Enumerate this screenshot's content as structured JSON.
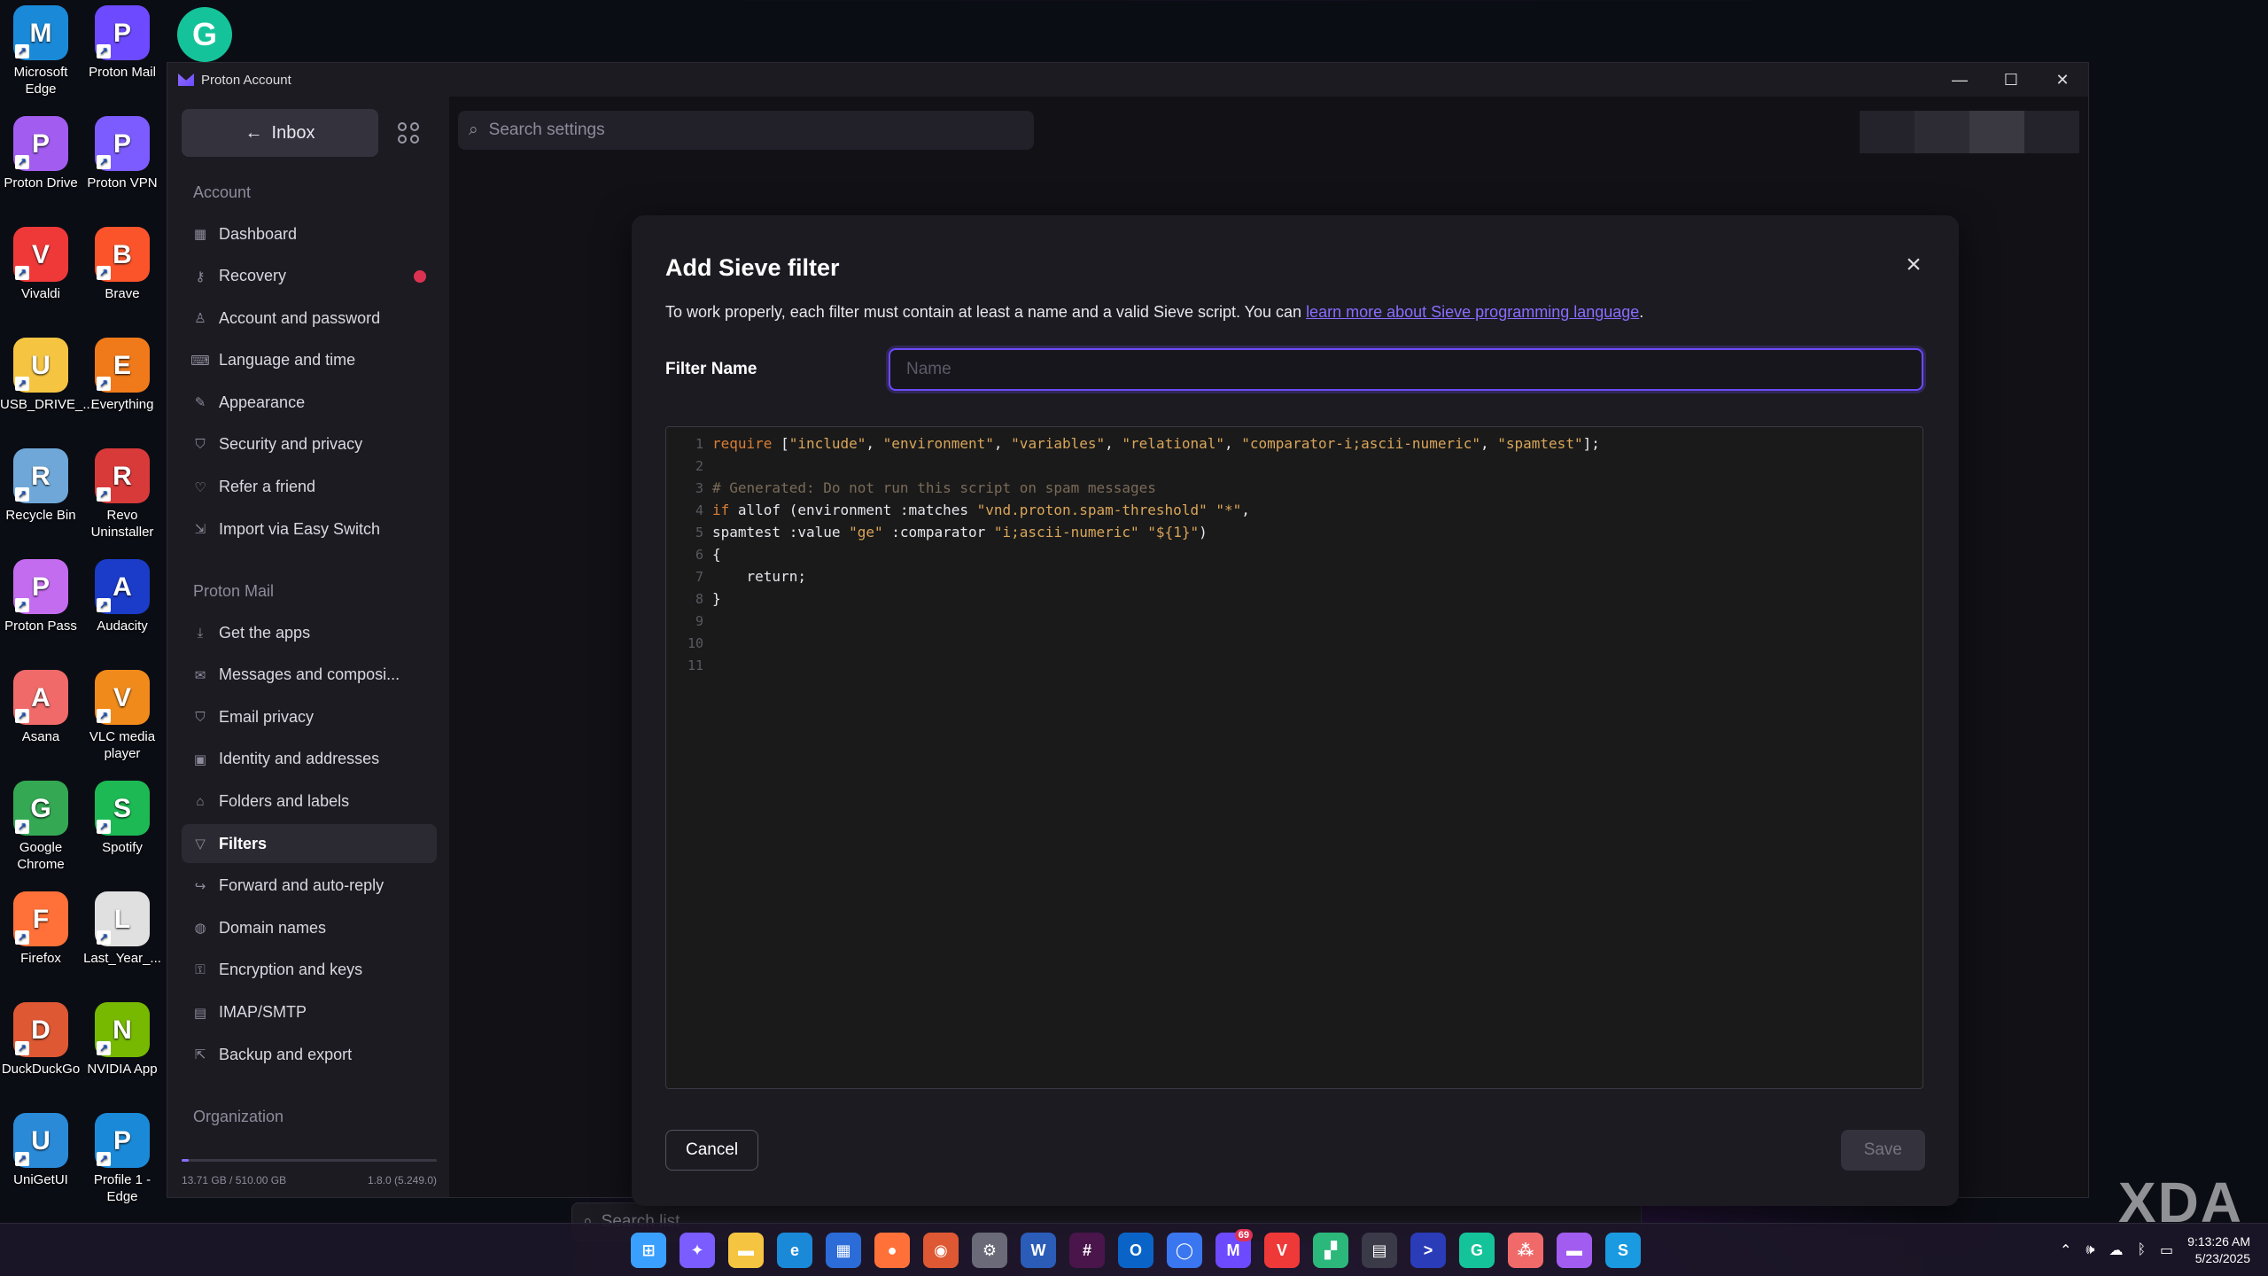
{
  "desktop": {
    "icons": [
      {
        "label": "Microsoft Edge",
        "icon": "edge-icon",
        "color": "#1a8ad8"
      },
      {
        "label": "Proton Mail",
        "icon": "proton-mail-icon",
        "color": "#6d4aff"
      },
      {
        "label": "Proton Drive",
        "icon": "proton-drive-icon",
        "color": "#a25cf0"
      },
      {
        "label": "Proton VPN",
        "icon": "proton-vpn-icon",
        "color": "#7d5cff"
      },
      {
        "label": "Vivaldi",
        "icon": "vivaldi-icon",
        "color": "#ef3939"
      },
      {
        "label": "Brave",
        "icon": "brave-icon",
        "color": "#fb542b"
      },
      {
        "label": "USB_DRIVE_...",
        "icon": "folder-icon",
        "color": "#f5c542"
      },
      {
        "label": "Everything",
        "icon": "everything-icon",
        "color": "#f07a1a"
      },
      {
        "label": "Recycle Bin",
        "icon": "recycle-bin-icon",
        "color": "#6fa8d8"
      },
      {
        "label": "Revo Uninstaller",
        "icon": "revo-uninstaller-icon",
        "color": "#d83a3a"
      },
      {
        "label": "Proton Pass",
        "icon": "proton-pass-icon",
        "color": "#c46cf0"
      },
      {
        "label": "Audacity",
        "icon": "audacity-icon",
        "color": "#1a3cc8"
      },
      {
        "label": "Asana",
        "icon": "asana-icon",
        "color": "#f06a6a"
      },
      {
        "label": "VLC media player",
        "icon": "vlc-icon",
        "color": "#f08a1a"
      },
      {
        "label": "Google Chrome",
        "icon": "chrome-icon",
        "color": "#34a853"
      },
      {
        "label": "Spotify",
        "icon": "spotify-icon",
        "color": "#1db954"
      },
      {
        "label": "Firefox",
        "icon": "firefox-icon",
        "color": "#ff7139"
      },
      {
        "label": "Last_Year_...",
        "icon": "document-icon",
        "color": "#e0e0e0"
      },
      {
        "label": "DuckDuckGo",
        "icon": "duckduckgo-icon",
        "color": "#de5833"
      },
      {
        "label": "NVIDIA App",
        "icon": "nvidia-icon",
        "color": "#76b900"
      },
      {
        "label": "UniGetUI",
        "icon": "unigetui-icon",
        "color": "#2a8ad8"
      },
      {
        "label": "Profile 1 - Edge",
        "icon": "edge-icon",
        "color": "#1a8ad8"
      }
    ],
    "top_icon": {
      "icon": "grammarly-icon",
      "color": "#15c39a"
    }
  },
  "window": {
    "title": "Proton Account",
    "controls": {
      "minimize": "—",
      "maximize": "☐",
      "close": "✕"
    }
  },
  "sidebar": {
    "inbox_label": "Inbox",
    "account_section": "Account",
    "account_items": [
      {
        "label": "Dashboard",
        "icon": "dashboard-icon"
      },
      {
        "label": "Recovery",
        "icon": "key-icon",
        "alert": true
      },
      {
        "label": "Account and password",
        "icon": "user-icon"
      },
      {
        "label": "Language and time",
        "icon": "language-icon"
      },
      {
        "label": "Appearance",
        "icon": "paint-icon"
      },
      {
        "label": "Security and privacy",
        "icon": "shield-icon"
      },
      {
        "label": "Refer a friend",
        "icon": "heart-icon"
      },
      {
        "label": "Import via Easy Switch",
        "icon": "import-icon"
      }
    ],
    "mail_section": "Proton Mail",
    "mail_items": [
      {
        "label": "Get the apps",
        "icon": "download-icon"
      },
      {
        "label": "Messages and composi...",
        "icon": "envelope-icon"
      },
      {
        "label": "Email privacy",
        "icon": "shield-icon"
      },
      {
        "label": "Identity and addresses",
        "icon": "id-card-icon"
      },
      {
        "label": "Folders and labels",
        "icon": "tag-icon"
      },
      {
        "label": "Filters",
        "icon": "filter-icon",
        "active": true
      },
      {
        "label": "Forward and auto-reply",
        "icon": "forward-icon"
      },
      {
        "label": "Domain names",
        "icon": "globe-icon"
      },
      {
        "label": "Encryption and keys",
        "icon": "lock-icon"
      },
      {
        "label": "IMAP/SMTP",
        "icon": "server-icon"
      },
      {
        "label": "Backup and export",
        "icon": "export-icon"
      }
    ],
    "org_section": "Organization",
    "storage": {
      "used": "13.71 GB",
      "total": "510.00 GB",
      "fraction": 0.027,
      "version": "1.8.0 (5.249.0)"
    }
  },
  "main": {
    "search_placeholder": "Search settings",
    "search_list_placeholder": "Search list"
  },
  "modal": {
    "title": "Add Sieve filter",
    "description": "To work properly, each filter must contain at least a name and a valid Sieve script. You can ",
    "link_text": "learn more about Sieve programming language",
    "description_end": ".",
    "filter_name_label": "Filter Name",
    "name_placeholder": "Name",
    "name_value": "",
    "code_lines": [
      {
        "n": "1",
        "parts": [
          {
            "t": "require",
            "c": "kw"
          },
          {
            "t": " [",
            "c": "tx"
          },
          {
            "t": "\"include\"",
            "c": "str"
          },
          {
            "t": ", ",
            "c": "tx"
          },
          {
            "t": "\"environment\"",
            "c": "str"
          },
          {
            "t": ", ",
            "c": "tx"
          },
          {
            "t": "\"variables\"",
            "c": "str"
          },
          {
            "t": ", ",
            "c": "tx"
          },
          {
            "t": "\"relational\"",
            "c": "str"
          },
          {
            "t": ", ",
            "c": "tx"
          },
          {
            "t": "\"comparator-i;ascii-numeric\"",
            "c": "str"
          },
          {
            "t": ", ",
            "c": "tx"
          },
          {
            "t": "\"spamtest\"",
            "c": "str"
          },
          {
            "t": "];",
            "c": "tx"
          }
        ]
      },
      {
        "n": "2",
        "parts": []
      },
      {
        "n": "3",
        "parts": [
          {
            "t": "# Generated: Do not run this script on spam messages",
            "c": "cm"
          }
        ]
      },
      {
        "n": "4",
        "parts": [
          {
            "t": "if",
            "c": "kw"
          },
          {
            "t": " allof (environment :matches ",
            "c": "tx"
          },
          {
            "t": "\"vnd.proton.spam-threshold\"",
            "c": "str"
          },
          {
            "t": " ",
            "c": "tx"
          },
          {
            "t": "\"*\"",
            "c": "str"
          },
          {
            "t": ",",
            "c": "tx"
          }
        ]
      },
      {
        "n": "5",
        "parts": [
          {
            "t": "spamtest :value ",
            "c": "tx"
          },
          {
            "t": "\"ge\"",
            "c": "str"
          },
          {
            "t": " :comparator ",
            "c": "tx"
          },
          {
            "t": "\"i;ascii-numeric\"",
            "c": "str"
          },
          {
            "t": " ",
            "c": "tx"
          },
          {
            "t": "\"${1}\"",
            "c": "str"
          },
          {
            "t": ")",
            "c": "tx"
          }
        ]
      },
      {
        "n": "6",
        "parts": [
          {
            "t": "{",
            "c": "tx"
          }
        ]
      },
      {
        "n": "7",
        "parts": [
          {
            "t": "    return;",
            "c": "tx"
          }
        ]
      },
      {
        "n": "8",
        "parts": [
          {
            "t": "}",
            "c": "tx"
          }
        ]
      },
      {
        "n": "9",
        "parts": []
      },
      {
        "n": "10",
        "parts": []
      },
      {
        "n": "11",
        "parts": []
      }
    ],
    "cancel_label": "Cancel",
    "save_label": "Save"
  },
  "taskbar": {
    "apps": [
      {
        "icon": "windows-start-icon",
        "color": "#3aa0ff",
        "glyph": "⊞"
      },
      {
        "icon": "copilot-icon",
        "color": "#7a5cff",
        "glyph": "✦"
      },
      {
        "icon": "file-explorer-icon",
        "color": "#f5c542",
        "glyph": "▬"
      },
      {
        "icon": "edge-icon",
        "color": "#1a8ad8",
        "glyph": "e"
      },
      {
        "icon": "store-icon",
        "color": "#2b6cd8",
        "glyph": "▦"
      },
      {
        "icon": "firefox-icon",
        "color": "#ff7139",
        "glyph": "●"
      },
      {
        "icon": "duckduckgo-icon",
        "color": "#de5833",
        "glyph": "◉"
      },
      {
        "icon": "settings-icon",
        "color": "#6a6a78",
        "glyph": "⚙"
      },
      {
        "icon": "word-icon",
        "color": "#2b5cb8",
        "glyph": "W"
      },
      {
        "icon": "slack-icon",
        "color": "#4a154b",
        "glyph": "#"
      },
      {
        "icon": "outlook-icon",
        "color": "#0a64c8",
        "glyph": "O"
      },
      {
        "icon": "signal-icon",
        "color": "#3a76f0",
        "glyph": "◯"
      },
      {
        "icon": "proton-mail-icon",
        "color": "#6d4aff",
        "glyph": "M",
        "badge": "69"
      },
      {
        "icon": "vivaldi-icon",
        "color": "#ef3939",
        "glyph": "V"
      },
      {
        "icon": "tiles-icon",
        "color": "#2bb87a",
        "glyph": "▞"
      },
      {
        "icon": "calculator-icon",
        "color": "#3a3a48",
        "glyph": "▤"
      },
      {
        "icon": "terminal-icon",
        "color": "#2b3cb8",
        "glyph": ">"
      },
      {
        "icon": "grammarly-icon",
        "color": "#15c39a",
        "glyph": "G"
      },
      {
        "icon": "asana-icon",
        "color": "#f06a6a",
        "glyph": "⁂"
      },
      {
        "icon": "folder-icon",
        "color": "#a25cf0",
        "glyph": "▬"
      },
      {
        "icon": "sticky-icon",
        "color": "#1a9ae0",
        "glyph": "S"
      }
    ],
    "time": "9:13:26 AM",
    "date": "5/23/2025"
  },
  "watermark": "XDA"
}
